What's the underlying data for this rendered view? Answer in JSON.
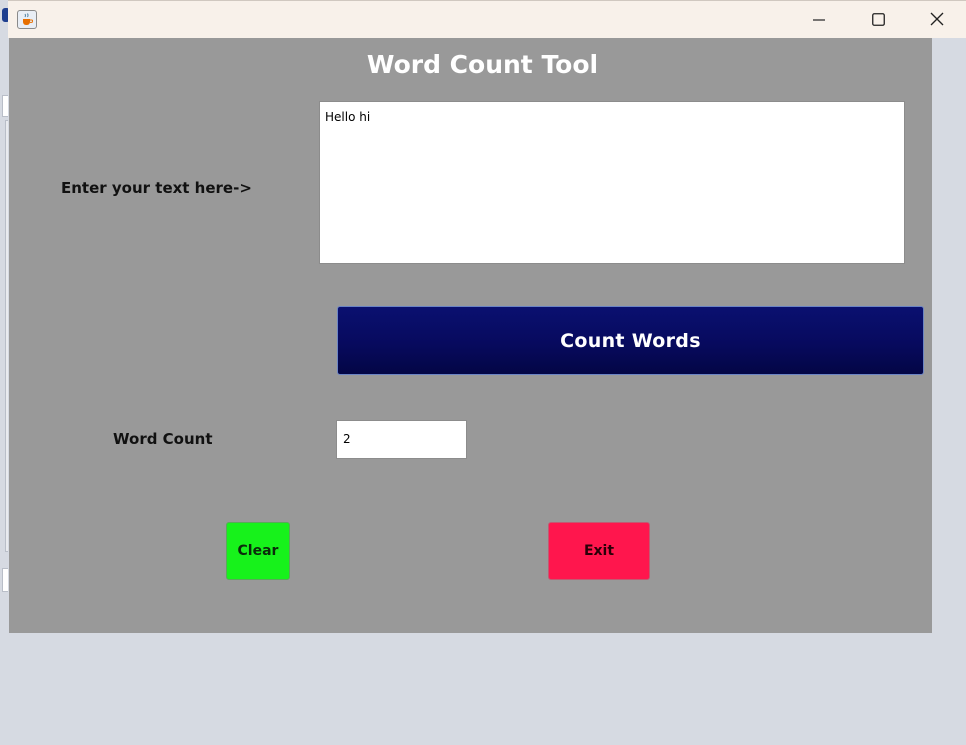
{
  "window": {
    "icon": "java-cup-icon",
    "controls": {
      "minimize_icon": "minimize-icon",
      "maximize_icon": "maximize-icon",
      "close_icon": "close-icon"
    }
  },
  "app": {
    "title": "Word Count Tool",
    "input_label": "Enter your text here->",
    "input_text": "Hello hi",
    "count_button_label": "Count Words",
    "word_count_label": "Word Count",
    "word_count_value": "2",
    "clear_button_label": "Clear",
    "exit_button_label": "Exit"
  },
  "colors": {
    "panel_background": "#999999",
    "count_button": "#07095e",
    "clear_button": "#17f21b",
    "exit_button": "#ff164d",
    "titlebar": "#f8f1ea"
  }
}
